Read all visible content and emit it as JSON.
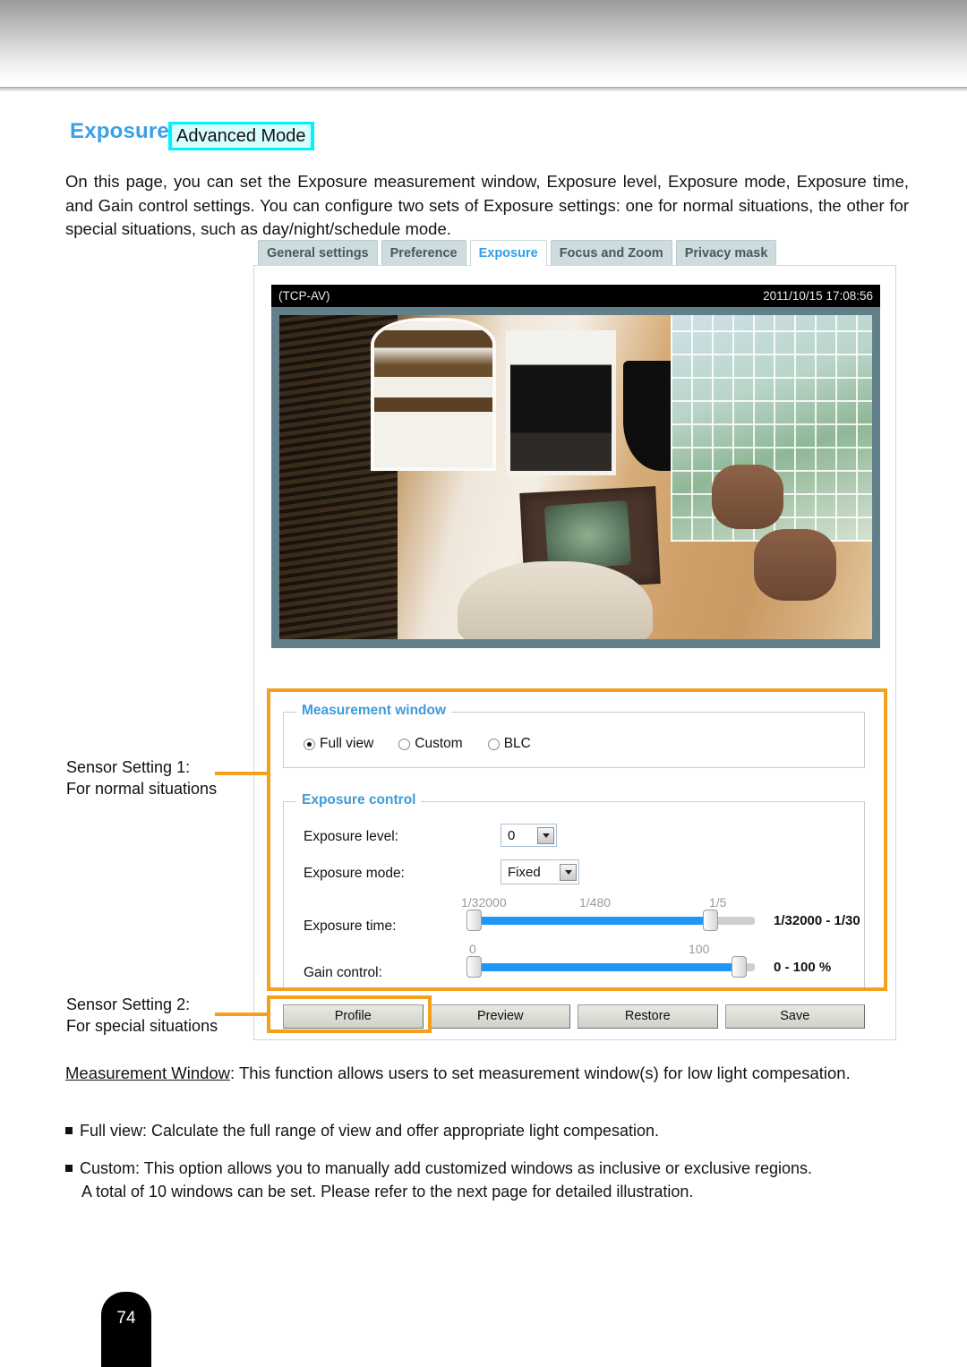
{
  "heading": {
    "title": "Exposure",
    "badge": "Advanced Mode"
  },
  "intro": "On this page, you can set the Exposure measurement window, Exposure level, Exposure mode, Exposure time, and Gain control settings. You can configure two sets of Exposure settings: one for normal situations, the other for special situations, such as day/night/schedule mode.",
  "ui": {
    "tabs": [
      {
        "label": "General settings",
        "active": false
      },
      {
        "label": "Preference",
        "active": false
      },
      {
        "label": "Exposure",
        "active": true
      },
      {
        "label": "Focus and Zoom",
        "active": false
      },
      {
        "label": "Privacy mask",
        "active": false
      }
    ],
    "video": {
      "stream_label": "(TCP-AV)",
      "timestamp": "2011/10/15 17:08:56"
    },
    "measurement_window": {
      "legend": "Measurement window",
      "options": [
        {
          "label": "Full view",
          "selected": true
        },
        {
          "label": "Custom",
          "selected": false
        },
        {
          "label": "BLC",
          "selected": false
        }
      ]
    },
    "exposure_control": {
      "legend": "Exposure control",
      "exposure_level": {
        "label": "Exposure level:",
        "value": "0"
      },
      "exposure_mode": {
        "label": "Exposure mode:",
        "value": "Fixed"
      },
      "exposure_time": {
        "label": "Exposure time:",
        "ticks": [
          "1/32000",
          "1/480",
          "1/5"
        ],
        "value": "1/32000 - 1/30"
      },
      "gain_control": {
        "label": "Gain control:",
        "ticks": [
          "0",
          "100"
        ],
        "value": "0 - 100 %"
      }
    },
    "buttons": [
      "Profile",
      "Preview",
      "Restore",
      "Save"
    ]
  },
  "annotations": {
    "sensor1_line1": "Sensor Setting 1:",
    "sensor1_line2": "For normal situations",
    "sensor2_line1": "Sensor Setting 2:",
    "sensor2_line2": "For special situations"
  },
  "body": {
    "measurement_term": "Measurement Window",
    "measurement_text": ": This function allows users to set measurement window(s) for low light compesation.",
    "bullet_full_view": "Full view: Calculate the full range of view and offer appropriate light compesation.",
    "bullet_custom": "Custom: This option allows you to manually add customized windows as inclusive or exclusive regions.",
    "bullet_custom_cont": "A total of 10 windows can be set. Please refer to the next page for detailed illustration."
  },
  "page_number": "74",
  "colors": {
    "accent_blue": "#3aa0e8",
    "badge_cyan": "#00f2ff",
    "highlight_orange": "#f5a01d",
    "slider_blue": "#2196f3"
  }
}
